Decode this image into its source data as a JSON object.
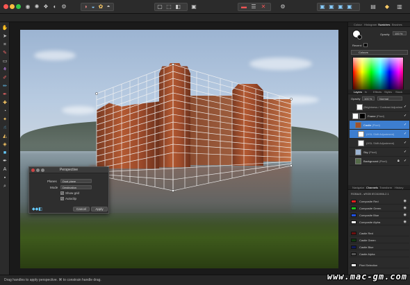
{
  "window": {
    "traffic_lights": [
      "#fc5753",
      "#fdbc40",
      "#33c748"
    ]
  },
  "toolbar": {
    "icons": [
      "persona-photo-icon",
      "persona-liquify-icon",
      "persona-develop-icon",
      "persona-tone-map-icon",
      "persona-export-icon"
    ]
  },
  "tools": [
    "hand-icon",
    "move-icon",
    "crop-icon",
    "selection-brush-icon",
    "marquee-icon",
    "flood-select-icon",
    "paint-brush-icon",
    "erase-icon",
    "clone-icon",
    "healing-icon",
    "dodge-icon",
    "blur-icon",
    "smudge-icon",
    "gradient-icon",
    "fill-icon",
    "pen-icon",
    "text-icon",
    "shape-icon",
    "color-swatch-icon",
    "zoom-icon"
  ],
  "dialog": {
    "title": "Perspective",
    "planes_label": "Planes",
    "planes_value": "Dual plane",
    "mode_label": "Mode",
    "mode_value": "Destination",
    "show_grid_label": "Show grid",
    "autoclip_label": "Autoclip",
    "cancel_label": "Cancel",
    "apply_label": "Apply"
  },
  "status": {
    "hint": "Drag handles to apply perspective. ⌘ to constrain handle drag."
  },
  "watermark": "www.mac-gm.com",
  "panels": {
    "top_tabs": [
      "Colour",
      "Histogram",
      "Swatches",
      "Brushes"
    ],
    "opacity_label": "Opacity",
    "opacity_value": "100 %",
    "recent_label": "Recent:",
    "palette_name": "Colours",
    "layer_tabs": [
      "Layers",
      "fx",
      "Effects",
      "Styles",
      "Stock"
    ],
    "layers_opacity": "100 %",
    "blend_mode": "Normal",
    "layers": [
      {
        "name": "",
        "sub": "(Brightness / Contrast Adjustme"
      },
      {
        "name": "Frame",
        "sub": "(Pixel)"
      },
      {
        "name": "Castle",
        "sub": "(Pixel)"
      },
      {
        "name": "",
        "sub": "(HSL Shift Adjustment)"
      },
      {
        "name": "",
        "sub": "(HSL Shift Adjustment)"
      },
      {
        "name": "Sky",
        "sub": "(Pixel)"
      },
      {
        "name": "Background",
        "sub": "(Pixel)"
      }
    ],
    "chan_tabs": [
      "Navigator",
      "Channels",
      "Transform",
      "History"
    ],
    "chan_info": "RGBA/8 - sRGB IEC61966-2.1",
    "channels": [
      {
        "name": "Composite Red",
        "color": "#e02020"
      },
      {
        "name": "Composite Green",
        "color": "#20c020"
      },
      {
        "name": "Composite Blue",
        "color": "#2050e0"
      },
      {
        "name": "Composite Alpha",
        "color": "#ffffff"
      },
      {
        "name": "Castle Red",
        "color": "#6a1010"
      },
      {
        "name": "Castle Green",
        "color": "#103a10"
      },
      {
        "name": "Castle Blue",
        "color": "#101a5a"
      },
      {
        "name": "Castle Alpha",
        "color": "#555555"
      },
      {
        "name": "Pixel Selection",
        "color": "#ffffff"
      }
    ]
  }
}
